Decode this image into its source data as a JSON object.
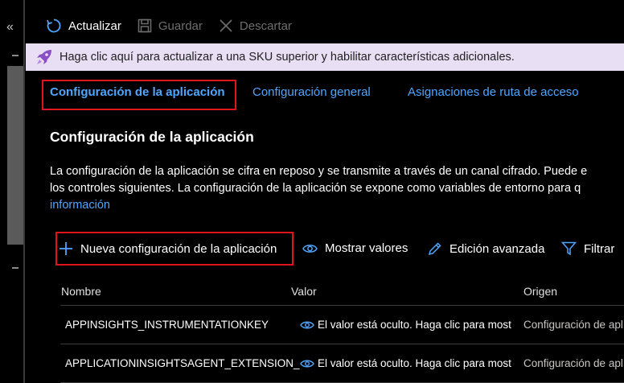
{
  "toolbar": {
    "refresh_label": "Actualizar",
    "save_label": "Guardar",
    "discard_label": "Descartar"
  },
  "banner": {
    "text": "Haga clic aquí para actualizar a una SKU superior y habilitar características adicionales."
  },
  "tabs": [
    {
      "label": "Configuración de la aplicación",
      "active": true
    },
    {
      "label": "Configuración general",
      "active": false
    },
    {
      "label": "Asignaciones de ruta de acceso",
      "active": false
    }
  ],
  "section": {
    "title": "Configuración de la aplicación",
    "desc_line1": "La configuración de la aplicación se cifra en reposo y se transmite a través de un canal cifrado. Puede e",
    "desc_line2": "los controles siguientes. La configuración de la aplicación se expone como variables de entorno para q",
    "desc_link": "información"
  },
  "actions": {
    "new_label": "Nueva configuración de la aplicación",
    "show_label": "Mostrar valores",
    "edit_label": "Edición avanzada",
    "filter_label": "Filtrar"
  },
  "table": {
    "headers": [
      "Nombre",
      "Valor",
      "Origen"
    ],
    "rows": [
      {
        "name": "APPINSIGHTS_INSTRUMENTATIONKEY",
        "value": "El valor está oculto. Haga clic para most",
        "source": "Configuración de apl"
      },
      {
        "name": "APPLICATIONINSIGHTSAGENT_EXTENSION_",
        "value": "El valor está oculto. Haga clic para most",
        "source": "Configuración de apl"
      }
    ]
  },
  "colors": {
    "accent": "#4fa6ff",
    "highlight_outline": "#e0141c",
    "banner_bg": "#e9dff5",
    "banner_icon": "#8a4fc4"
  }
}
